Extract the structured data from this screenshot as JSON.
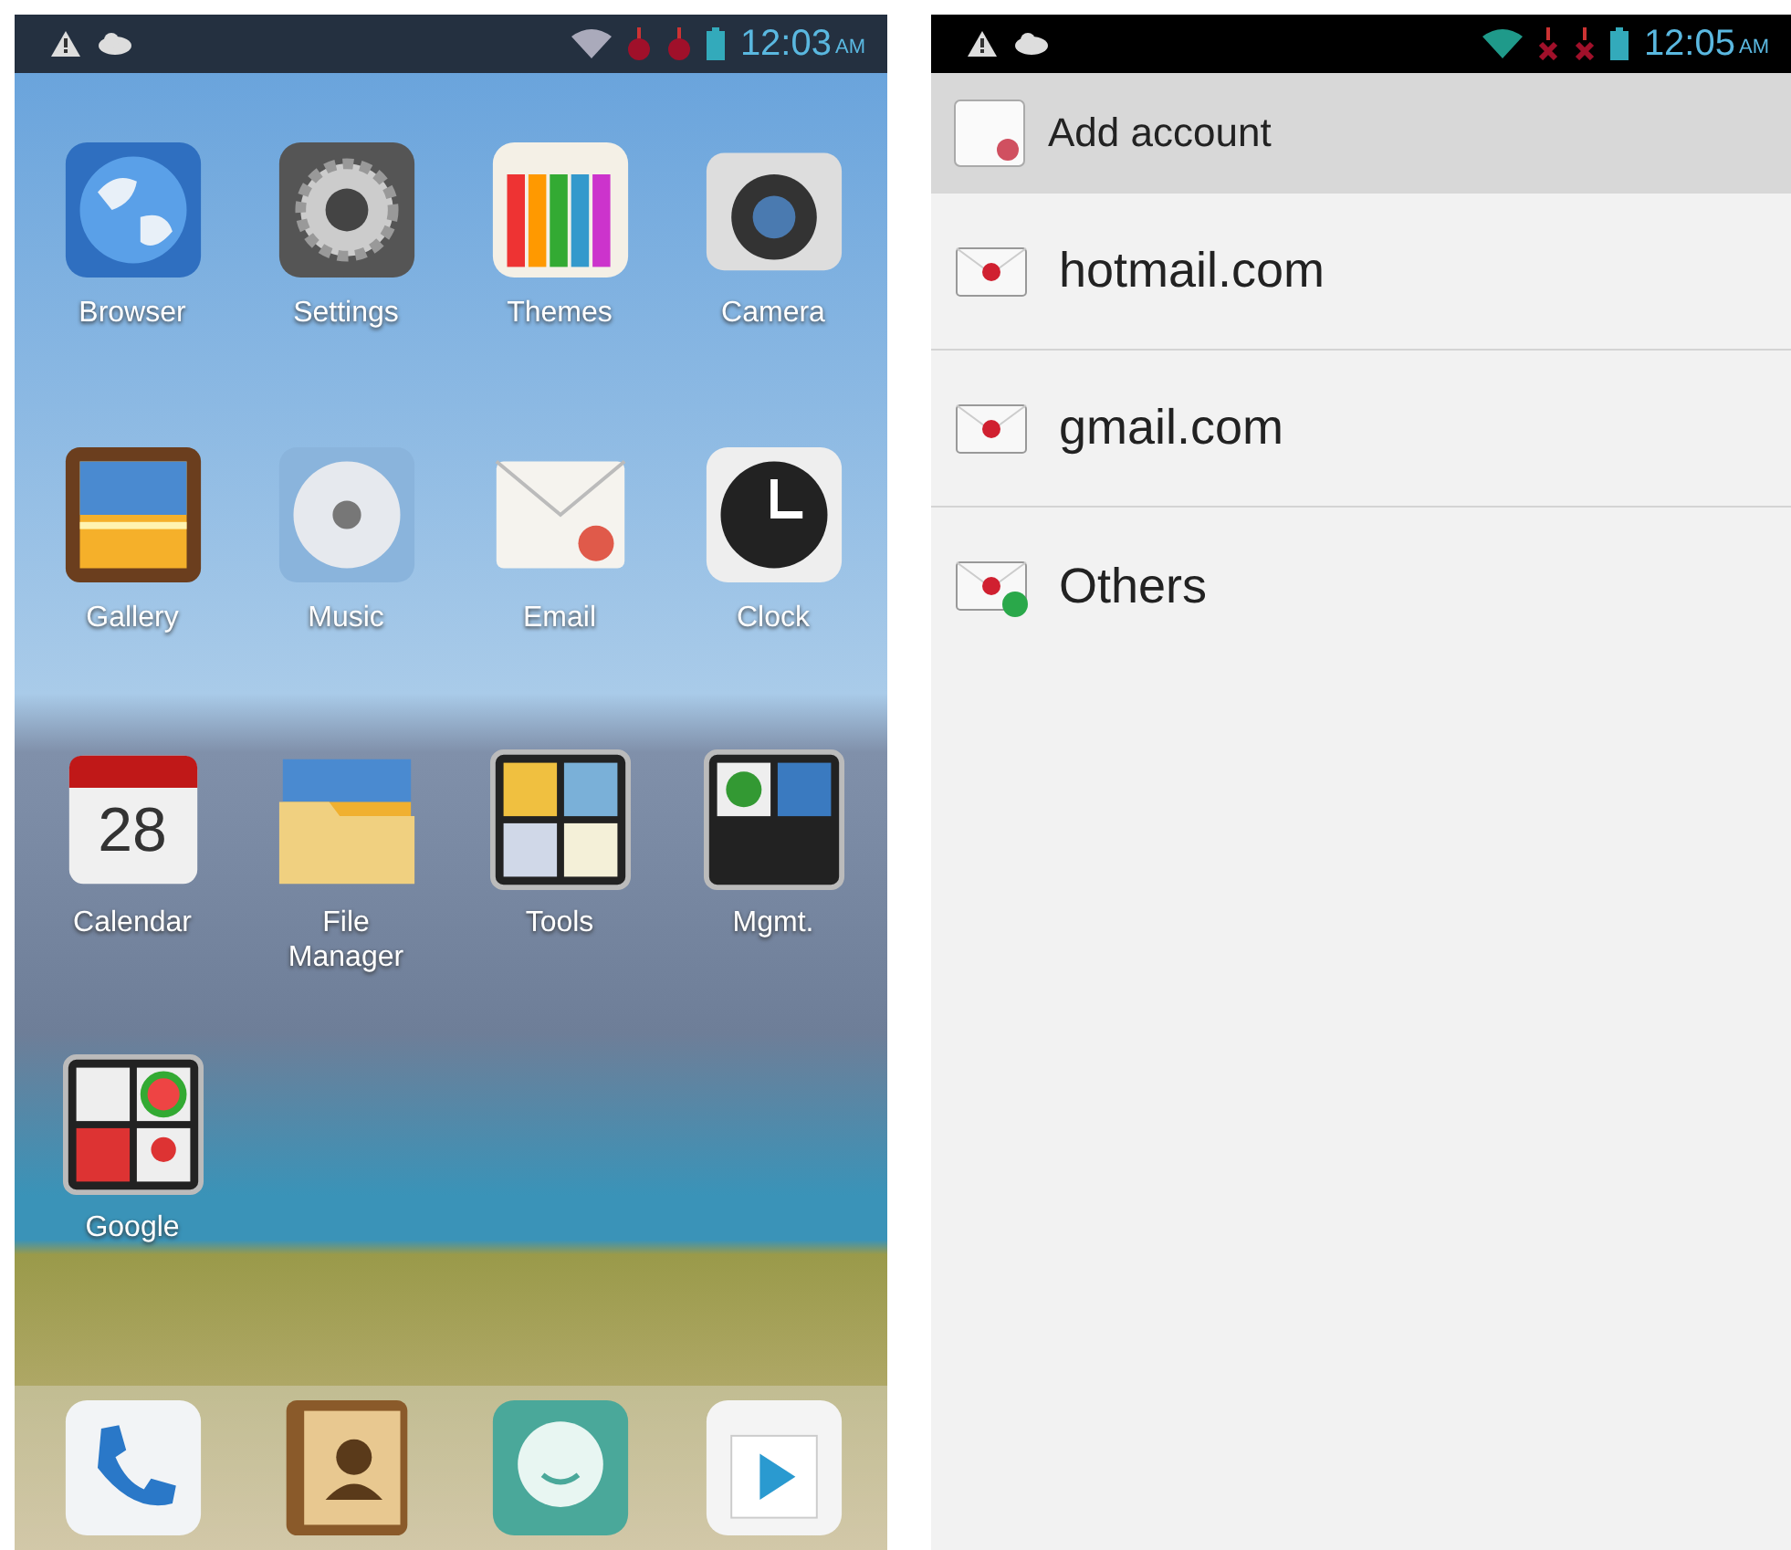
{
  "home_screen": {
    "status_bar": {
      "time": "12:03",
      "meridiem": "AM"
    },
    "apps": [
      {
        "label": "Browser",
        "kind": "globe"
      },
      {
        "label": "Settings",
        "kind": "gear"
      },
      {
        "label": "Themes",
        "kind": "pencils"
      },
      {
        "label": "Camera",
        "kind": "camera"
      },
      {
        "label": "Gallery",
        "kind": "picture"
      },
      {
        "label": "Music",
        "kind": "disc"
      },
      {
        "label": "Email",
        "kind": "envelope"
      },
      {
        "label": "Clock",
        "kind": "clock"
      },
      {
        "label": "Calendar",
        "kind": "calendar",
        "date": "28"
      },
      {
        "label": "File Manager",
        "kind": "folder"
      },
      {
        "label": "Tools",
        "kind": "tools-folder"
      },
      {
        "label": "Mgmt.",
        "kind": "mgmt-folder"
      },
      {
        "label": "Google",
        "kind": "google-folder"
      }
    ],
    "dock": [
      {
        "kind": "phone"
      },
      {
        "kind": "contacts"
      },
      {
        "kind": "messaging"
      },
      {
        "kind": "store"
      }
    ]
  },
  "add_account_screen": {
    "status_bar": {
      "time": "12:05",
      "meridiem": "AM"
    },
    "title": "Add account",
    "accounts": [
      {
        "label": "hotmail.com",
        "kind": "mail"
      },
      {
        "label": "gmail.com",
        "kind": "mail"
      },
      {
        "label": "Others",
        "kind": "mail-other"
      }
    ]
  }
}
